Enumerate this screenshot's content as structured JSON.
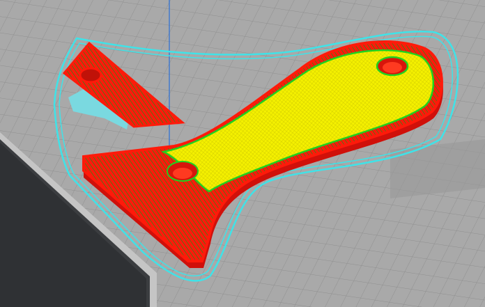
{
  "viewport": {
    "view": "layer-preview",
    "colors": {
      "build_plate": "#a9a9a9",
      "grid_line": "#8c8c8c",
      "background": "#3b3d40",
      "axis_line": "#2a6fd6",
      "skirt": "#3fe3e8",
      "wall_outer": "#ff1a0a",
      "wall_inner": "#1fd21f",
      "skin": "#f4f000",
      "support": "#7ad9e0"
    }
  }
}
